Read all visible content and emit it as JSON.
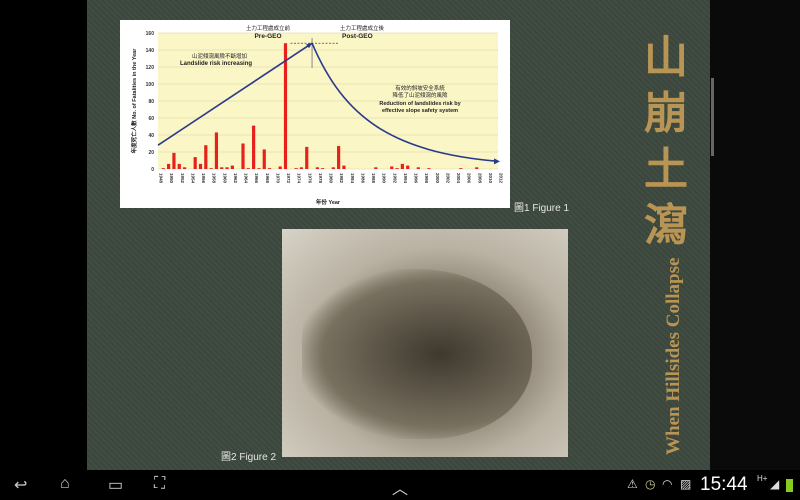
{
  "document": {
    "title_cn": "山崩土瀉",
    "title_en": "When Hillsides Collapse",
    "figure1_caption": "圖1 Figure 1",
    "figure2_caption": "圖2 Figure 2"
  },
  "chart_data": {
    "type": "bar",
    "ylabel": "年度死亡人數 No. of Fatalities in the Year",
    "xlabel": "年份 Year",
    "ylim": [
      0,
      160
    ],
    "yticks": [
      0,
      20,
      40,
      60,
      80,
      100,
      120,
      140,
      160
    ],
    "xticks": [
      1948,
      1950,
      1952,
      1954,
      1956,
      1958,
      1960,
      1962,
      1964,
      1966,
      1968,
      1970,
      1972,
      1974,
      1976,
      1978,
      1980,
      1982,
      1984,
      1986,
      1988,
      1990,
      1992,
      1994,
      1996,
      1998,
      2000,
      2002,
      2004,
      2006,
      2008,
      2010,
      2012
    ],
    "bar_color": "#e8201c",
    "years": [
      1949,
      1950,
      1951,
      1952,
      1953,
      1955,
      1956,
      1957,
      1958,
      1959,
      1960,
      1961,
      1962,
      1964,
      1965,
      1966,
      1967,
      1968,
      1969,
      1971,
      1972,
      1974,
      1975,
      1976,
      1978,
      1979,
      1981,
      1982,
      1983,
      1989,
      1992,
      1993,
      1994,
      1995,
      1997,
      1999,
      2005,
      2008
    ],
    "values": [
      1,
      6,
      19,
      6,
      2,
      14,
      6,
      28,
      1,
      43,
      2,
      2,
      4,
      30,
      1,
      51,
      1,
      23,
      1,
      3,
      148,
      1,
      2,
      26,
      2,
      1,
      2,
      27,
      4,
      2,
      3,
      1,
      6,
      4,
      2,
      1,
      1,
      2
    ],
    "annotations": {
      "pre_cn": "土力工程處成立前",
      "pre_en": "Pre-GEO",
      "post_cn": "土力工程處成立後",
      "post_en": "Post-GEO",
      "rise_cn": "山泥傾瀉風險不斷增加",
      "rise_en": "Landslide risk increasing",
      "fall_cn": "有效的斜坡安全系統",
      "fall_cn2": "降低了山泥傾瀉的風險",
      "fall_en": "Reduction of landslides risk by",
      "fall_en2": "effective slope safety system"
    }
  },
  "status": {
    "time": "15:44",
    "network": "H+"
  },
  "icons": [
    "back-icon",
    "home-icon",
    "recent-apps-icon",
    "screenshot-icon",
    "chevron-up-icon",
    "warning-icon",
    "clock-icon",
    "wifi-icon",
    "image-icon",
    "signal-icon",
    "battery-icon"
  ]
}
